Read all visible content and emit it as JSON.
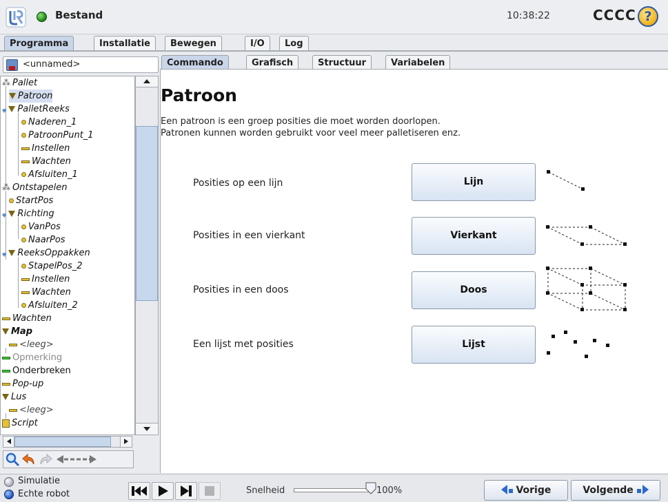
{
  "titlebar": {
    "status": "Bestand",
    "clock": "10:38:22",
    "robot_name": "CCCC",
    "help_glyph": "?"
  },
  "top_tabs": [
    "Programma",
    "Installatie",
    "Bewegen",
    "I/O",
    "Log"
  ],
  "program": {
    "name": "<unnamed>"
  },
  "sub_tabs": [
    "Commando",
    "Grafisch",
    "Structuur",
    "Variabelen"
  ],
  "tree": [
    {
      "label": "Pallet",
      "icon": "dots-icon"
    },
    {
      "label": "Patroon",
      "icon": "triangle-icon",
      "selected": true
    },
    {
      "label": "PalletReeks",
      "icon": "triangle-icon"
    },
    {
      "label": "Naderen_1",
      "icon": "waypoint-icon"
    },
    {
      "label": "PatroonPunt_1",
      "icon": "waypoint-icon"
    },
    {
      "label": "Instellen",
      "icon": "bar-icon"
    },
    {
      "label": "Wachten",
      "icon": "bar-icon"
    },
    {
      "label": "Afsluiten_1",
      "icon": "waypoint-icon"
    },
    {
      "label": "Ontstapelen",
      "icon": "dots-icon"
    },
    {
      "label": "StartPos",
      "icon": "waypoint-icon"
    },
    {
      "label": "Richting",
      "icon": "triangle-icon"
    },
    {
      "label": "VanPos",
      "icon": "waypoint-icon"
    },
    {
      "label": "NaarPos",
      "icon": "waypoint-icon"
    },
    {
      "label": "ReeksOppakken",
      "icon": "triangle-icon"
    },
    {
      "label": "StapelPos_2",
      "icon": "waypoint-icon"
    },
    {
      "label": "Instellen",
      "icon": "bar-icon"
    },
    {
      "label": "Wachten",
      "icon": "bar-icon"
    },
    {
      "label": "Afsluiten_2",
      "icon": "waypoint-icon"
    },
    {
      "label": "Wachten",
      "icon": "bar-icon"
    },
    {
      "label": "Map",
      "icon": "triangle-icon"
    },
    {
      "label": "<leeg>",
      "icon": "bar-icon"
    },
    {
      "label": "Opmerking",
      "icon": "green-bar-icon"
    },
    {
      "label": "Onderbreken",
      "icon": "green-bar-icon"
    },
    {
      "label": "Pop-up",
      "icon": "bar-icon"
    },
    {
      "label": "Lus",
      "icon": "triangle-icon"
    },
    {
      "label": "<leeg>",
      "icon": "bar-icon"
    },
    {
      "label": "Script",
      "icon": "script-icon"
    }
  ],
  "page": {
    "title": "Patroon",
    "description_1": "Een patroon is een groep posities die moet worden doorlopen.",
    "description_2": "Patronen kunnen worden gebruikt voor veel meer palletiseren enz."
  },
  "options": [
    {
      "label": "Posities op een lijn",
      "button": "Lijn"
    },
    {
      "label": "Posities in een vierkant",
      "button": "Vierkant"
    },
    {
      "label": "Posities in een doos",
      "button": "Doos"
    },
    {
      "label": "Een lijst met posities",
      "button": "Lijst"
    }
  ],
  "bottom": {
    "simulation": "Simulatie",
    "real_robot": "Echte robot",
    "speed_label": "Snelheid",
    "speed_value": "100%",
    "speed_fraction": 1.0,
    "prev": "Vorige",
    "next": "Volgende"
  },
  "colors": {
    "accent_blue": "#2c6ac8",
    "status_green": "#1f8a18",
    "active_tab": "#c9d6ea"
  }
}
